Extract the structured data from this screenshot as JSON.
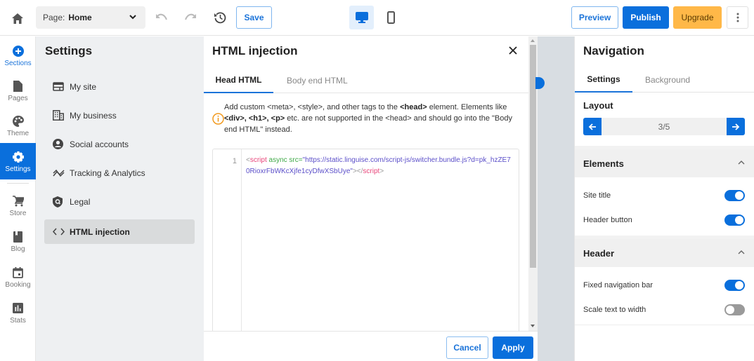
{
  "topbar": {
    "page_label": "Page:",
    "page_value": "Home",
    "save_label": "Save",
    "preview_label": "Preview",
    "publish_label": "Publish",
    "upgrade_label": "Upgrade",
    "icons": [
      "home-icon",
      "chevron-down-icon",
      "undo-icon",
      "redo-icon",
      "history-icon",
      "desktop-icon",
      "mobile-icon",
      "more-vertical-icon"
    ]
  },
  "rail": {
    "items": [
      {
        "label": "Sections",
        "icon": "plus-circle-icon"
      },
      {
        "label": "Pages",
        "icon": "page-icon"
      },
      {
        "label": "Theme",
        "icon": "palette-icon"
      },
      {
        "label": "Settings",
        "icon": "gear-icon",
        "active": true
      },
      {
        "label": "Store",
        "icon": "cart-icon"
      },
      {
        "label": "Blog",
        "icon": "book-icon"
      },
      {
        "label": "Booking",
        "icon": "calendar-icon"
      },
      {
        "label": "Stats",
        "icon": "stats-icon"
      }
    ]
  },
  "settings": {
    "title": "Settings",
    "items": [
      {
        "label": "My site",
        "icon": "site-icon"
      },
      {
        "label": "My business",
        "icon": "building-icon"
      },
      {
        "label": "Social accounts",
        "icon": "account-icon"
      },
      {
        "label": "Tracking & Analytics",
        "icon": "analytics-icon"
      },
      {
        "label": "Legal",
        "icon": "shield-icon"
      },
      {
        "label": "HTML injection",
        "icon": "code-icon",
        "active": true
      }
    ]
  },
  "modal": {
    "title": "HTML injection",
    "tabs": [
      {
        "label": "Head HTML",
        "active": true
      },
      {
        "label": "Body end HTML",
        "active": false
      }
    ],
    "info": {
      "part1": "Add custom <meta>, <style>, and other tags to the ",
      "bold1": "<head>",
      "part2": " element. Elements like ",
      "bold2": "<div>, <h1>, <p>",
      "part3": " etc. are not supported in the <head> and should go into the \"Body end HTML\" instead."
    },
    "editor": {
      "line_number": "1",
      "code": {
        "open_lt": "<",
        "tag_open": "script",
        "attr_async": " async src=",
        "value": "\"https://static.linguise.com/script-js/switcher.bundle.js?d=pk_hzZE70RioxrFbWKcXjfe1cyDfwXSbUye\"",
        "close_gt": "></",
        "tag_close": "script",
        "end_gt": ">"
      }
    },
    "cancel_label": "Cancel",
    "apply_label": "Apply"
  },
  "right_panel": {
    "title": "Navigation",
    "tabs": [
      {
        "label": "Settings",
        "active": true
      },
      {
        "label": "Background",
        "active": false
      }
    ],
    "layout": {
      "label": "Layout",
      "value": "3/5"
    },
    "groups": [
      {
        "title": "Elements",
        "expanded": true,
        "rows": [
          {
            "label": "Site title",
            "enabled": true
          },
          {
            "label": "Header button",
            "enabled": true
          }
        ]
      },
      {
        "title": "Header",
        "expanded": true,
        "rows": [
          {
            "label": "Fixed navigation bar",
            "enabled": true
          },
          {
            "label": "Scale text to width",
            "enabled": false
          }
        ]
      }
    ]
  },
  "colors": {
    "primary": "#0a6fdc",
    "upgrade": "#ffb848",
    "info_icon": "#f29a1e",
    "code_tag": "#e8457a",
    "code_attr": "#3ea846",
    "code_value": "#5b4fc9"
  }
}
